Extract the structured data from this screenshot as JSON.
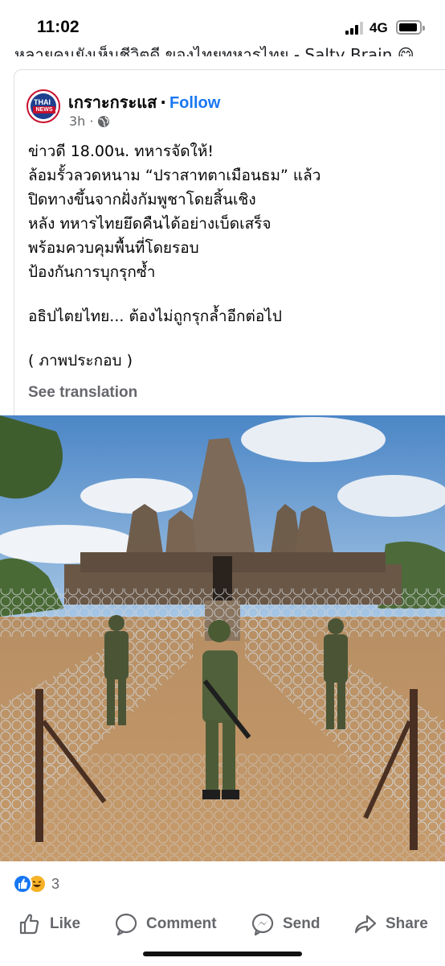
{
  "status_bar": {
    "time": "11:02",
    "network": "4G",
    "battery_level": 0.8
  },
  "cut_off_text": "หลายคนยังเห็นชีวิตดี ของไทยทหารไทย - Salty Brain 😋",
  "post": {
    "page_name": "เกราะกระแส",
    "separator": "·",
    "follow_label": "Follow",
    "time_ago": "3h",
    "time_dot": "·",
    "avatar_text_top": "THAI",
    "avatar_text_bottom": "NEWS",
    "body_lines": [
      "ข่าวดี 18.00น. ทหารจัดให้!",
      "ล้อมรั้วลวดหนาม “ปราสาทตาเมือนธม” แล้ว",
      "ปิดทางขึ้นจากฝั่งกัมพูชาโดยสิ้นเชิง",
      "หลัง ทหารไทยยึดคืนได้อย่างเบ็ดเสร็จ",
      "พร้อมควบคุมพื้นที่โดยรอบ",
      "ป้องกันการบุกรุกซ้ำ",
      "",
      "อธิปไตยไทย... ต้องไม่ถูกรุกล้ำอีกต่อไป",
      "",
      "( ภาพประกอบ )"
    ],
    "see_translation": "See translation"
  },
  "reactions": {
    "count": "3",
    "types": [
      "like-icon",
      "haha-icon"
    ]
  },
  "actions": {
    "like": "Like",
    "comment": "Comment",
    "send": "Send",
    "share": "Share"
  },
  "colors": {
    "facebook_blue": "#1877f2",
    "secondary_text": "#65676b",
    "haha_yellow": "#f7b125"
  }
}
